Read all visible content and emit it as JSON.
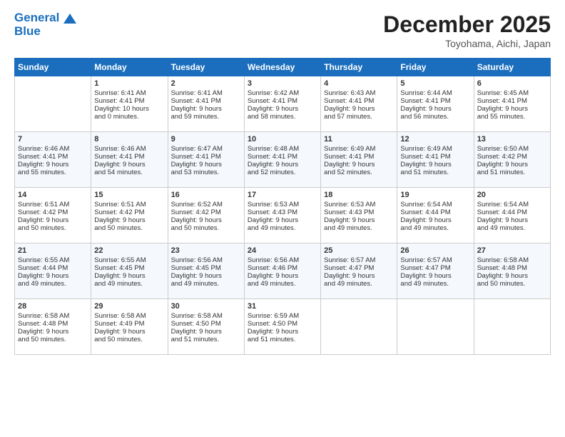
{
  "header": {
    "logo_line1": "General",
    "logo_line2": "Blue",
    "month_title": "December 2025",
    "location": "Toyohama, Aichi, Japan"
  },
  "weekdays": [
    "Sunday",
    "Monday",
    "Tuesday",
    "Wednesday",
    "Thursday",
    "Friday",
    "Saturday"
  ],
  "rows": [
    [
      {
        "day": "",
        "info": ""
      },
      {
        "day": "1",
        "info": "Sunrise: 6:41 AM\nSunset: 4:41 PM\nDaylight: 10 hours\nand 0 minutes."
      },
      {
        "day": "2",
        "info": "Sunrise: 6:41 AM\nSunset: 4:41 PM\nDaylight: 9 hours\nand 59 minutes."
      },
      {
        "day": "3",
        "info": "Sunrise: 6:42 AM\nSunset: 4:41 PM\nDaylight: 9 hours\nand 58 minutes."
      },
      {
        "day": "4",
        "info": "Sunrise: 6:43 AM\nSunset: 4:41 PM\nDaylight: 9 hours\nand 57 minutes."
      },
      {
        "day": "5",
        "info": "Sunrise: 6:44 AM\nSunset: 4:41 PM\nDaylight: 9 hours\nand 56 minutes."
      },
      {
        "day": "6",
        "info": "Sunrise: 6:45 AM\nSunset: 4:41 PM\nDaylight: 9 hours\nand 55 minutes."
      }
    ],
    [
      {
        "day": "7",
        "info": "Sunrise: 6:46 AM\nSunset: 4:41 PM\nDaylight: 9 hours\nand 55 minutes."
      },
      {
        "day": "8",
        "info": "Sunrise: 6:46 AM\nSunset: 4:41 PM\nDaylight: 9 hours\nand 54 minutes."
      },
      {
        "day": "9",
        "info": "Sunrise: 6:47 AM\nSunset: 4:41 PM\nDaylight: 9 hours\nand 53 minutes."
      },
      {
        "day": "10",
        "info": "Sunrise: 6:48 AM\nSunset: 4:41 PM\nDaylight: 9 hours\nand 52 minutes."
      },
      {
        "day": "11",
        "info": "Sunrise: 6:49 AM\nSunset: 4:41 PM\nDaylight: 9 hours\nand 52 minutes."
      },
      {
        "day": "12",
        "info": "Sunrise: 6:49 AM\nSunset: 4:41 PM\nDaylight: 9 hours\nand 51 minutes."
      },
      {
        "day": "13",
        "info": "Sunrise: 6:50 AM\nSunset: 4:42 PM\nDaylight: 9 hours\nand 51 minutes."
      }
    ],
    [
      {
        "day": "14",
        "info": "Sunrise: 6:51 AM\nSunset: 4:42 PM\nDaylight: 9 hours\nand 50 minutes."
      },
      {
        "day": "15",
        "info": "Sunrise: 6:51 AM\nSunset: 4:42 PM\nDaylight: 9 hours\nand 50 minutes."
      },
      {
        "day": "16",
        "info": "Sunrise: 6:52 AM\nSunset: 4:42 PM\nDaylight: 9 hours\nand 50 minutes."
      },
      {
        "day": "17",
        "info": "Sunrise: 6:53 AM\nSunset: 4:43 PM\nDaylight: 9 hours\nand 49 minutes."
      },
      {
        "day": "18",
        "info": "Sunrise: 6:53 AM\nSunset: 4:43 PM\nDaylight: 9 hours\nand 49 minutes."
      },
      {
        "day": "19",
        "info": "Sunrise: 6:54 AM\nSunset: 4:44 PM\nDaylight: 9 hours\nand 49 minutes."
      },
      {
        "day": "20",
        "info": "Sunrise: 6:54 AM\nSunset: 4:44 PM\nDaylight: 9 hours\nand 49 minutes."
      }
    ],
    [
      {
        "day": "21",
        "info": "Sunrise: 6:55 AM\nSunset: 4:44 PM\nDaylight: 9 hours\nand 49 minutes."
      },
      {
        "day": "22",
        "info": "Sunrise: 6:55 AM\nSunset: 4:45 PM\nDaylight: 9 hours\nand 49 minutes."
      },
      {
        "day": "23",
        "info": "Sunrise: 6:56 AM\nSunset: 4:45 PM\nDaylight: 9 hours\nand 49 minutes."
      },
      {
        "day": "24",
        "info": "Sunrise: 6:56 AM\nSunset: 4:46 PM\nDaylight: 9 hours\nand 49 minutes."
      },
      {
        "day": "25",
        "info": "Sunrise: 6:57 AM\nSunset: 4:47 PM\nDaylight: 9 hours\nand 49 minutes."
      },
      {
        "day": "26",
        "info": "Sunrise: 6:57 AM\nSunset: 4:47 PM\nDaylight: 9 hours\nand 49 minutes."
      },
      {
        "day": "27",
        "info": "Sunrise: 6:58 AM\nSunset: 4:48 PM\nDaylight: 9 hours\nand 50 minutes."
      }
    ],
    [
      {
        "day": "28",
        "info": "Sunrise: 6:58 AM\nSunset: 4:48 PM\nDaylight: 9 hours\nand 50 minutes."
      },
      {
        "day": "29",
        "info": "Sunrise: 6:58 AM\nSunset: 4:49 PM\nDaylight: 9 hours\nand 50 minutes."
      },
      {
        "day": "30",
        "info": "Sunrise: 6:58 AM\nSunset: 4:50 PM\nDaylight: 9 hours\nand 51 minutes."
      },
      {
        "day": "31",
        "info": "Sunrise: 6:59 AM\nSunset: 4:50 PM\nDaylight: 9 hours\nand 51 minutes."
      },
      {
        "day": "",
        "info": ""
      },
      {
        "day": "",
        "info": ""
      },
      {
        "day": "",
        "info": ""
      }
    ]
  ]
}
